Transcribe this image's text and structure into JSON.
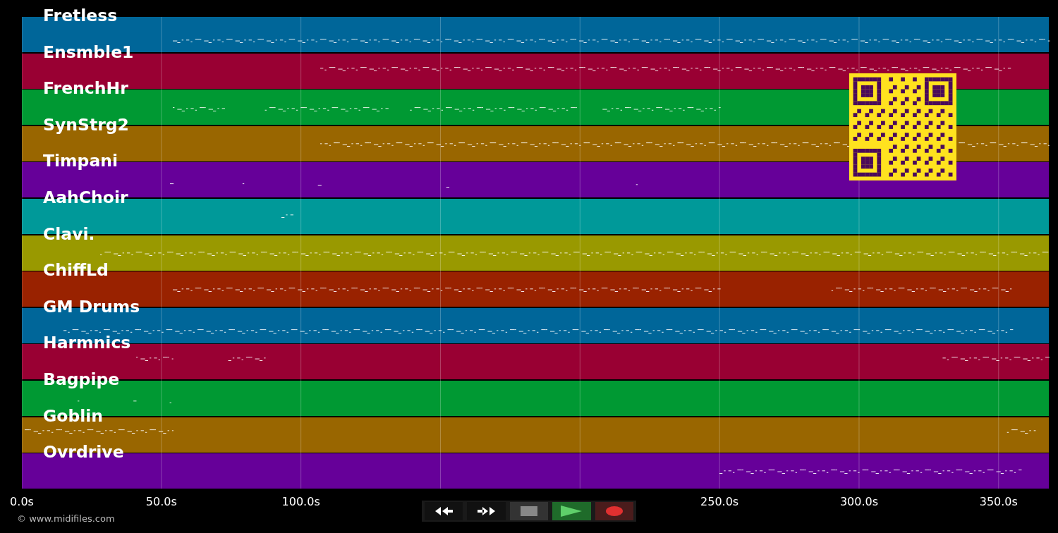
{
  "tracks": [
    {
      "name": "Fretless",
      "color": "#006699"
    },
    {
      "name": "Ensmble1",
      "color": "#990033"
    },
    {
      "name": "FrenchHr",
      "color": "#009933"
    },
    {
      "name": "SynStrg2",
      "color": "#996600"
    },
    {
      "name": "Timpani",
      "color": "#660099"
    },
    {
      "name": "AahChoir",
      "color": "#009999"
    },
    {
      "name": "Clavi.",
      "color": "#999900"
    },
    {
      "name": "ChiffLd",
      "color": "#992200"
    },
    {
      "name": "GM Drums",
      "color": "#006699"
    },
    {
      "name": "Harmnics",
      "color": "#990033"
    },
    {
      "name": "Bagpipe",
      "color": "#009933"
    },
    {
      "name": "Goblin",
      "color": "#996600"
    },
    {
      "name": "Ovrdrive",
      "color": "#660099"
    }
  ],
  "axis": {
    "ticks": [
      "0.0s",
      "50.0s",
      "100.0s",
      "250.0s",
      "300.0s",
      "350.0s"
    ]
  },
  "footer": {
    "copyright": "© www.midifiles.com"
  }
}
